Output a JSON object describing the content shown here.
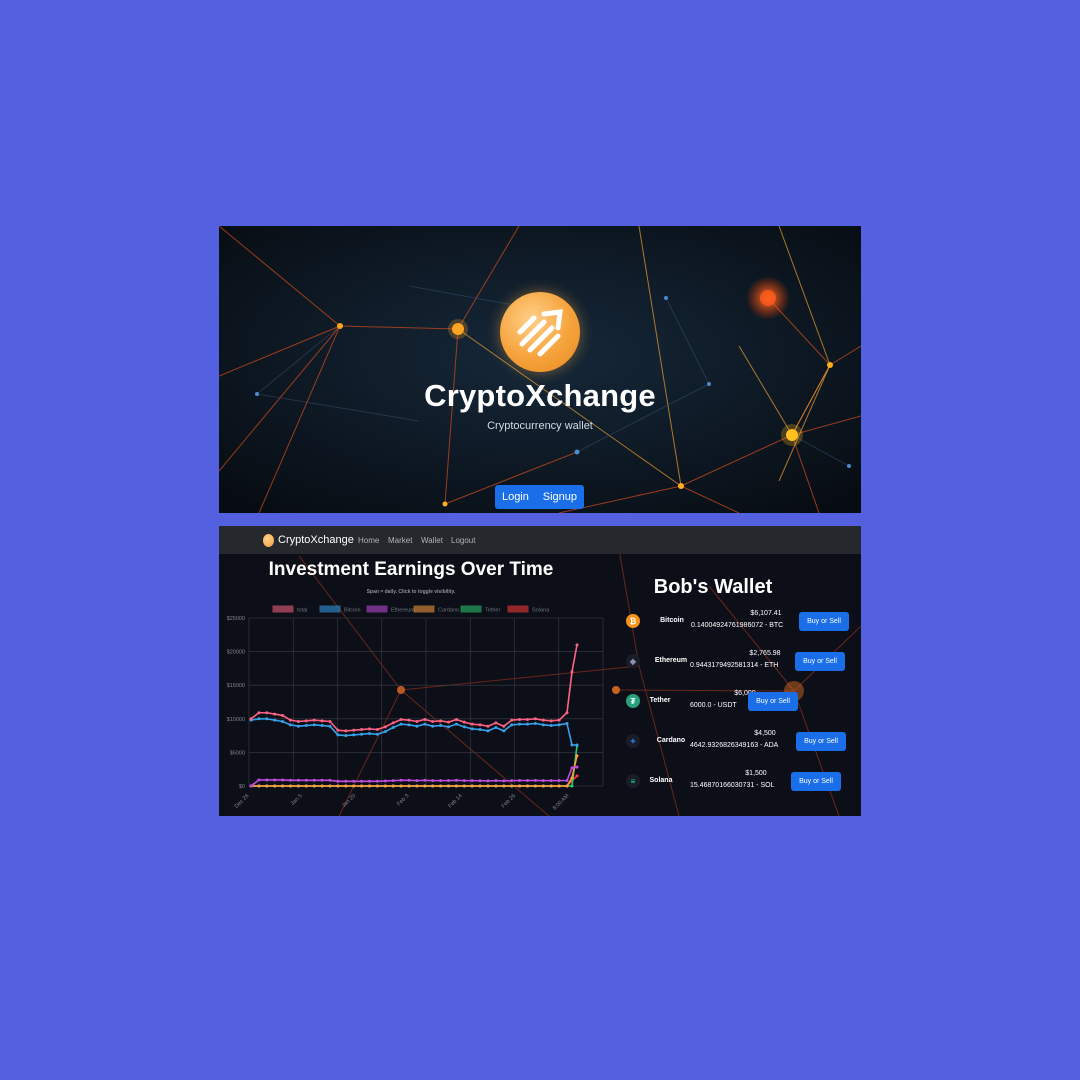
{
  "hero": {
    "title": "CryptoXchange",
    "subtitle": "Cryptocurrency wallet",
    "login_label": "Login",
    "signup_label": "Signup",
    "logo_icon": "trend-arrow-icon"
  },
  "navbar": {
    "brand": "CryptoXchange",
    "links": [
      "Home",
      "Market",
      "Wallet",
      "Logout"
    ]
  },
  "chart_section": {
    "title": "Investment Earnings Over Time",
    "subtitle": "Span = daily. Click to toggle visibility."
  },
  "chart_data": {
    "type": "line",
    "ylim": [
      0,
      25000
    ],
    "ytick_labels": [
      "$0",
      "$5000",
      "$10000",
      "$15000",
      "$20000",
      "$25000"
    ],
    "xtick_labels": [
      "Dec 26",
      "Jan 5",
      "Jan 20",
      "Feb 3",
      "Feb 14",
      "Feb 26",
      "8:00 AM"
    ],
    "grid": true,
    "legend_position": "top",
    "series": [
      {
        "name": "total",
        "color": "#ff6384",
        "values": [
          10000,
          10900,
          10900,
          10700,
          10500,
          9800,
          9600,
          9700,
          9800,
          9700,
          9600,
          8300,
          8200,
          8300,
          8400,
          8500,
          8400,
          8800,
          9400,
          9900,
          9800,
          9600,
          9900,
          9600,
          9700,
          9500,
          9900,
          9500,
          9200,
          9100,
          8900,
          9400,
          8900,
          9800,
          9900,
          9900,
          10000,
          9800,
          9700,
          9800,
          10900,
          17000,
          21000
        ]
      },
      {
        "name": "Bitcoin",
        "color": "#36a2eb",
        "values": [
          9800,
          10000,
          10000,
          9800,
          9600,
          9100,
          8900,
          9000,
          9100,
          9000,
          8900,
          7600,
          7500,
          7600,
          7700,
          7800,
          7700,
          8100,
          8700,
          9200,
          9100,
          8900,
          9200,
          8900,
          9000,
          8800,
          9200,
          8800,
          8500,
          8400,
          8200,
          8700,
          8200,
          9100,
          9200,
          9200,
          9300,
          9100,
          9000,
          9100,
          9300,
          6100,
          6100
        ]
      },
      {
        "name": "Ethereum",
        "color": "#c04ce0",
        "values": [
          0,
          900,
          900,
          900,
          900,
          850,
          850,
          850,
          850,
          850,
          850,
          700,
          700,
          700,
          700,
          700,
          700,
          750,
          800,
          850,
          850,
          800,
          850,
          800,
          800,
          800,
          850,
          800,
          800,
          780,
          760,
          800,
          760,
          800,
          820,
          820,
          830,
          800,
          800,
          800,
          820,
          2700,
          2800
        ]
      },
      {
        "name": "Cardano",
        "color": "#ff9f40",
        "values": [
          0,
          0,
          0,
          0,
          0,
          0,
          0,
          0,
          0,
          0,
          0,
          0,
          0,
          0,
          0,
          0,
          0,
          0,
          0,
          0,
          0,
          0,
          0,
          0,
          0,
          0,
          0,
          0,
          0,
          0,
          0,
          0,
          0,
          0,
          0,
          0,
          0,
          0,
          0,
          0,
          0,
          1200,
          4500
        ]
      },
      {
        "name": "Tether",
        "color": "#2ecc71",
        "values": [
          0,
          0,
          0,
          0,
          0,
          0,
          0,
          0,
          0,
          0,
          0,
          0,
          0,
          0,
          0,
          0,
          0,
          0,
          0,
          0,
          0,
          0,
          0,
          0,
          0,
          0,
          0,
          0,
          0,
          0,
          0,
          0,
          0,
          0,
          0,
          0,
          0,
          0,
          0,
          0,
          0,
          0,
          6000
        ]
      },
      {
        "name": "Solana",
        "color": "#ff3b3b",
        "values": [
          0,
          0,
          0,
          0,
          0,
          0,
          0,
          0,
          0,
          0,
          0,
          0,
          0,
          0,
          0,
          0,
          0,
          0,
          0,
          0,
          0,
          0,
          0,
          0,
          0,
          0,
          0,
          0,
          0,
          0,
          0,
          0,
          0,
          0,
          0,
          0,
          0,
          0,
          0,
          0,
          0,
          800,
          1500
        ]
      }
    ]
  },
  "wallet": {
    "title": "Bob's Wallet",
    "button_label": "Buy or Sell",
    "coins": [
      {
        "name": "Bitcoin",
        "usd": "$6,107.41",
        "amount": "0.14004924761986072 - BTC",
        "icon": "bitcoin-icon",
        "color": "#f7931a"
      },
      {
        "name": "Ethereum",
        "usd": "$2,765.98",
        "amount": "0.9443179492581314 - ETH",
        "icon": "ethereum-icon",
        "color": "#8a92b2"
      },
      {
        "name": "Tether",
        "usd": "$6,000",
        "amount": "6000.0 - USDT",
        "icon": "tether-icon",
        "color": "#26a17b"
      },
      {
        "name": "Cardano",
        "usd": "$4,500",
        "amount": "4642.9326826349163 - ADA",
        "icon": "cardano-icon",
        "color": "#2a71d0"
      },
      {
        "name": "Solana",
        "usd": "$1,500",
        "amount": "15.46870166030731 - SOL",
        "icon": "solana-icon",
        "color": "#14f195"
      }
    ]
  }
}
